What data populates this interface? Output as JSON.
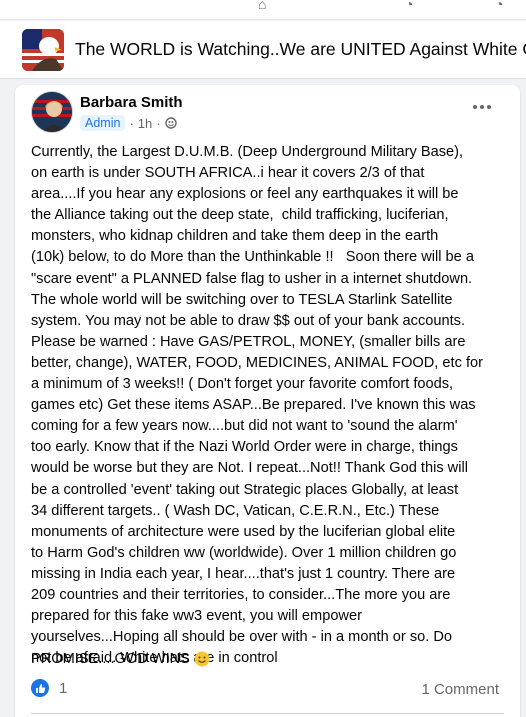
{
  "group": {
    "title": "The WORLD is Watching..We are UNITED Against White Ge"
  },
  "post": {
    "author": "Barbara Smith",
    "role_badge": "Admin",
    "separator": "·",
    "time": "1h",
    "body": "Currently, the Largest D.U.M.B. (Deep Underground Military Base),\non earth is under SOUTH AFRICA..i hear it covers 2/3 of that\narea....If you hear any explosions or feel any earthquakes it will be\nthe Alliance taking out the deep state,  child trafficking, luciferian,\nmonsters, who kidnap children and take them deep in the earth\n(10k) below, to do More than the Unthinkable !!   Soon there will be a\n\"scare event\" a PLANNED false flag to usher in a internet shutdown.\nThe whole world will be switching over to TESLA Starlink Satellite\nsystem. You may not be able to draw $$ out of your bank accounts.\nPlease be warned : Have GAS/PETROL, MONEY, (smaller bills are\nbetter, change), WATER, FOOD, MEDICINES, ANIMAL FOOD, etc for\na minimum of 3 weeks!! ( Don't forget your favorite comfort foods,\ngames etc) Get these items ASAP...Be prepared. I've known this was\ncoming for a few years now....but did not want to 'sound the alarm'\ntoo early. Know that if the Nazi World Order were in charge, things\nwould be worse but they are Not. I repeat...Not!! Thank God this will\nbe a controlled 'event' taking out Strategic places Globally, at least\n34 different targets.. ( Wash DC, Vatican, C.E.R.N., Etc.) These\nmonuments of architecture were used by the luciferian global elite\nto Harm God's children ww (worldwide). Over 1 million children go\nmissing in India each year, I hear....that's just 1 country. There are\n209 countries and their territories, to consider...The more you are\nprepared for this fake ww3 event, you will empower\nyourselves...Hoping all should be over with - in a month or so. Do\nnot be afraid. White hats are in control",
    "closing": "PROMISE....GOD WINS",
    "reaction_count": "1",
    "comments_label": "1 Comment"
  },
  "icons": {
    "privacy": "globe-icon",
    "more": "more-dots-icon",
    "reaction": "like-icon",
    "emoji": "smile-emoji-icon"
  },
  "colors": {
    "accent": "#1b74e4",
    "badge_bg": "#e7f3ff",
    "muted": "#65676b"
  }
}
